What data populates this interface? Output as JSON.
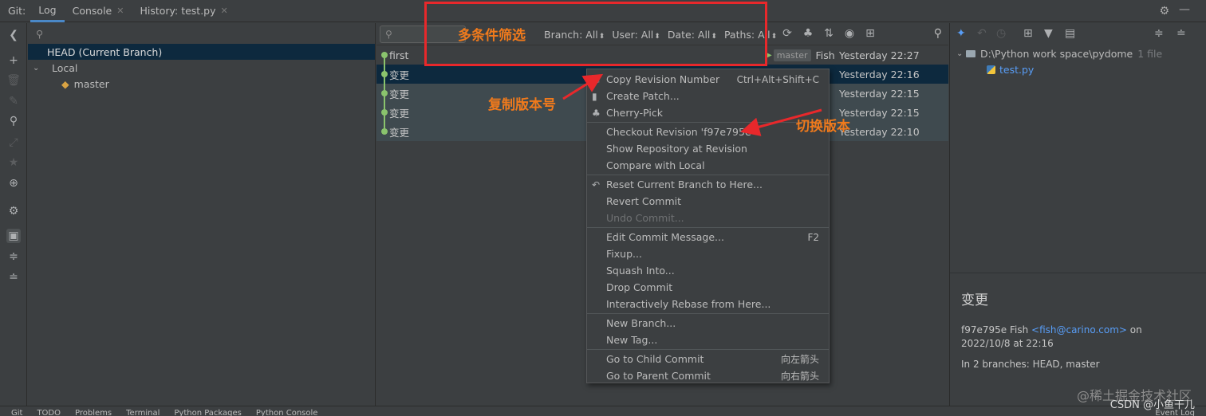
{
  "tabbar": {
    "prefix": "Git:",
    "tabs": [
      {
        "label": "Log"
      },
      {
        "label": "Console"
      },
      {
        "label": "History: test.py"
      }
    ]
  },
  "branches": {
    "head": "HEAD (Current Branch)",
    "local": "Local",
    "master": "master"
  },
  "filters": {
    "branch": "Branch: All",
    "user": "User: All",
    "date": "Date: All",
    "paths": "Paths: All"
  },
  "commits": [
    {
      "message": "first",
      "branch_tag": "master",
      "author": "Fish",
      "date": "Yesterday 22:27"
    },
    {
      "message": "变更",
      "author": "",
      "date": "Yesterday 22:16"
    },
    {
      "message": "变更",
      "author": "",
      "date": "Yesterday 22:15"
    },
    {
      "message": "变更",
      "author": "",
      "date": "Yesterday 22:15"
    },
    {
      "message": "变更",
      "author": "",
      "date": "Yesterday 22:10"
    }
  ],
  "context_menu": {
    "copy_revision": "Copy Revision Number",
    "copy_revision_shortcut": "Ctrl+Alt+Shift+C",
    "create_patch": "Create Patch...",
    "cherry_pick": "Cherry-Pick",
    "checkout_revision": "Checkout Revision 'f97e795e'",
    "show_repository": "Show Repository at Revision",
    "compare_local": "Compare with Local",
    "reset_branch": "Reset Current Branch to Here...",
    "revert_commit": "Revert Commit",
    "undo_commit": "Undo Commit...",
    "edit_message": "Edit Commit Message...",
    "edit_message_shortcut": "F2",
    "fixup": "Fixup...",
    "squash": "Squash Into...",
    "drop_commit": "Drop Commit",
    "rebase": "Interactively Rebase from Here...",
    "new_branch": "New Branch...",
    "new_tag": "New Tag...",
    "go_child": "Go to Child Commit",
    "go_child_shortcut": "向左箭头",
    "go_parent": "Go to Parent Commit",
    "go_parent_shortcut": "向右箭头"
  },
  "details": {
    "folder": "D:\\Python work space\\pydome",
    "folder_count": "1 file",
    "file": "test.py",
    "title": "变更",
    "hash_author": "f97e795e Fish",
    "email": "<fish@carino.com>",
    "on": "on",
    "date": "2022/10/8 at 22:16",
    "branches": "In 2 branches: HEAD, master"
  },
  "annotations": {
    "filter_note": "多条件筛选",
    "copy_note": "复制版本号",
    "switch_note": "切换版本",
    "highlight_color": "#e8282b",
    "note_color": "#f07a1c"
  },
  "bottombar": {
    "items": [
      "Git",
      "TODO",
      "Problems",
      "Terminal",
      "Python Packages",
      "Python Console"
    ],
    "event_log": "Event Log"
  },
  "watermark": {
    "line1": "@稀土掘金技术社区",
    "line2": "CSDN @小鱼干儿"
  }
}
